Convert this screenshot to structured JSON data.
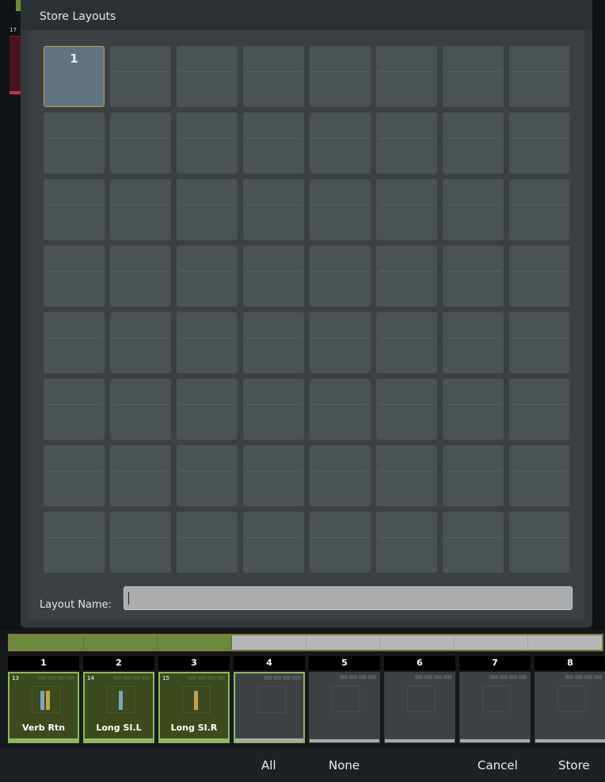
{
  "dialog": {
    "title": "Store Layouts",
    "active_cell_label": "1",
    "name_label": "Layout Name:",
    "name_value": ""
  },
  "side": {
    "left_channel": "17"
  },
  "bank_bar": {
    "segments": 8,
    "active_segments": 3
  },
  "strips": [
    {
      "slot": "1",
      "channel": "13",
      "name": "Verb Rtn",
      "assigned": true
    },
    {
      "slot": "2",
      "channel": "14",
      "name": "Long SI.L",
      "assigned": true
    },
    {
      "slot": "3",
      "channel": "15",
      "name": "Long SI.R",
      "assigned": true
    },
    {
      "slot": "4",
      "channel": "",
      "name": "",
      "assigned": false,
      "selected": true
    },
    {
      "slot": "5",
      "channel": "",
      "name": "",
      "assigned": false
    },
    {
      "slot": "6",
      "channel": "",
      "name": "",
      "assigned": false
    },
    {
      "slot": "7",
      "channel": "",
      "name": "",
      "assigned": false
    },
    {
      "slot": "8",
      "channel": "",
      "name": "",
      "assigned": false
    }
  ],
  "actions": {
    "all": "All",
    "none": "None",
    "cancel": "Cancel",
    "store": "Store"
  },
  "colors": {
    "accent_gold": "#c9a43c",
    "assigned_green": "#8fb85b",
    "active_cell": "#5f7382"
  }
}
